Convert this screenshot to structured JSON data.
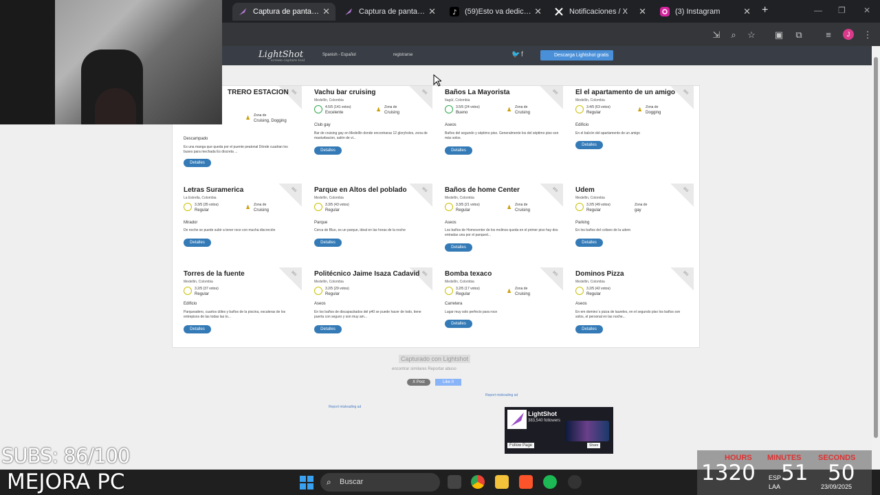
{
  "browser": {
    "tabs": [
      {
        "label": "Captura de pantalla pc",
        "active": true
      },
      {
        "label": "Captura de pantalla pc",
        "active": false
      },
      {
        "label": "(59)Esto va dedicado a",
        "active": false
      },
      {
        "label": "Notificaciones / X",
        "active": false
      },
      {
        "label": "(3) Instagram",
        "active": false
      }
    ],
    "new_tab": "+",
    "profile_initial": "J"
  },
  "lightshot": {
    "logo": "LightShot",
    "logo_sub": "screen capture tool",
    "language": "Spanish - Español",
    "register": "registrarse",
    "download": "Descarga Lightshot gratis",
    "captured": "Capturado con Lightshot",
    "links": "encontrar similares   Reportar abuso",
    "post": "X Post",
    "like": "Like 0",
    "report_ad": "Report misleading ad",
    "fb_title": "LightShot",
    "fb_followers": "383,540 followers",
    "fb_follow": "Follow Page",
    "fb_share": "Share"
  },
  "cards": [
    {
      "title": "TRERO ESTACION",
      "loc": "",
      "rating": "",
      "rword": "",
      "zone_label": "Zona de",
      "zone": "Cruising, Dogging",
      "type": "Descampado",
      "desc": "Es una manga que queda por el puente peatonal Dónde cuadran los buses para mechada Es discreta ...",
      "btn": "Detalles"
    },
    {
      "title": "Vachu bar cruising",
      "loc": "Medellín, Colombia",
      "rating": "4.5/5 (141 votos)",
      "rword": "Excelente",
      "zone_label": "Zona de",
      "zone": "Cruising",
      "type": "Club gay",
      "desc": "Bar de cruising gay en Medellín donde encontraras 12 gloryholes, zona de masturbacion, salón de vi...",
      "btn": "Detalles"
    },
    {
      "title": "Baños La Mayorista",
      "loc": "Itagüí, Colombia",
      "rating": "3.5/5 (24 votos)",
      "rword": "Bueno",
      "zone_label": "Zona de",
      "zone": "Cruising",
      "type": "Aseos",
      "desc": "Baños del segundo y séptimo piso. Generalmente los del séptimo piso son más solos.",
      "btn": "Detalles"
    },
    {
      "title": "El el apartamento de un amigo",
      "loc": "Medellín, Colombia",
      "rating": "3.4/5 (63 votos)",
      "rword": "Regular",
      "zone_label": "Zona de",
      "zone": "Dogging",
      "type": "Edificio",
      "desc": "En el balcón del apartamento de un amigo",
      "btn": "Detalles"
    },
    {
      "title": "Letras Suramerica",
      "loc": "La Estrella, Colombia",
      "rating": "3.3/5 (35 votos)",
      "rword": "Regular",
      "zone_label": "Zona de",
      "zone": "Cruising",
      "type": "Mirador",
      "desc": "De noche se puede subir a tener roce con mucha discreción",
      "btn": "Detalles"
    },
    {
      "title": "Parque en Altos del poblado",
      "loc": "Medellín, Colombia",
      "rating": "3.3/5 (43 votos)",
      "rword": "Regular",
      "zone_label": "",
      "zone": "",
      "type": "Parque",
      "desc": "Cerca de Bluo, es un parque, ideal en las horas de la noche",
      "btn": "Detalles"
    },
    {
      "title": "Baños de home Center",
      "loc": "Medellín, Colombia",
      "rating": "3.3/5 (21 votos)",
      "rword": "Regular",
      "zone_label": "Zona de",
      "zone": "Cruising",
      "type": "Aseos",
      "desc": "Los baños de Homecenter de los molinos queda en el primer piso hay dos entradas una por el parqued...",
      "btn": "Detalles"
    },
    {
      "title": "Udem",
      "loc": "Medellín, Colombia",
      "rating": "3.2/5 (49 votos)",
      "rword": "Regular",
      "zone_label": "Zona de",
      "zone": "gay",
      "type": "Parking",
      "desc": "En los baños del coliseo de la udem",
      "btn": "Detalles"
    },
    {
      "title": "Torres de la fuente",
      "loc": "Medellín, Colombia",
      "rating": "3.2/5 (37 votos)",
      "rword": "Regular",
      "zone_label": "",
      "zone": "",
      "type": "Edificio",
      "desc": "Parqueadero, cuartos útiles y baños de la piscina, escaleras de los entrepisos de las todas las to...",
      "btn": "Detalles"
    },
    {
      "title": "Politécnico Jaime Isaza Cadavid",
      "loc": "Medellín, Colombia",
      "rating": "3.2/5 (29 votos)",
      "rword": "Regular",
      "zone_label": "",
      "zone": "",
      "type": "Aseos",
      "desc": "En los baños de discapacitados del p40 se puede hacer de todo, tiene puerta con seguro y son muy am...",
      "btn": "Detalles"
    },
    {
      "title": "Bomba texaco",
      "loc": "Medellín, Colombia",
      "rating": "3.2/5 (17 votos)",
      "rword": "Regular",
      "zone_label": "Zona de",
      "zone": "Cruising",
      "type": "Carretera",
      "desc": "Lugar muy solo perfecto para roce",
      "btn": "Detalles"
    },
    {
      "title": "Dominos Pizza",
      "loc": "Medellín, Colombia",
      "rating": "3.2/5 (42 votos)",
      "rword": "Regular",
      "zone_label": "",
      "zone": "",
      "type": "Aseos",
      "desc": "En em domino´s pizza de laureles, en el segundo piso los baños son solos, el personal en las noche...",
      "btn": "Detalles"
    }
  ],
  "ribbon": "365",
  "taskbar": {
    "search": "Buscar"
  },
  "overlay": {
    "subs": "SUBS: 86/100",
    "mejora": "MEJORA PC",
    "hours_label": "HOURS",
    "minutes_label": "MINUTES",
    "seconds_label": "SECONDS",
    "hours": "1320",
    "minutes": "51",
    "seconds": "50",
    "lang": "ESP",
    "lang2": "LAA",
    "date": "23/09/2025"
  }
}
